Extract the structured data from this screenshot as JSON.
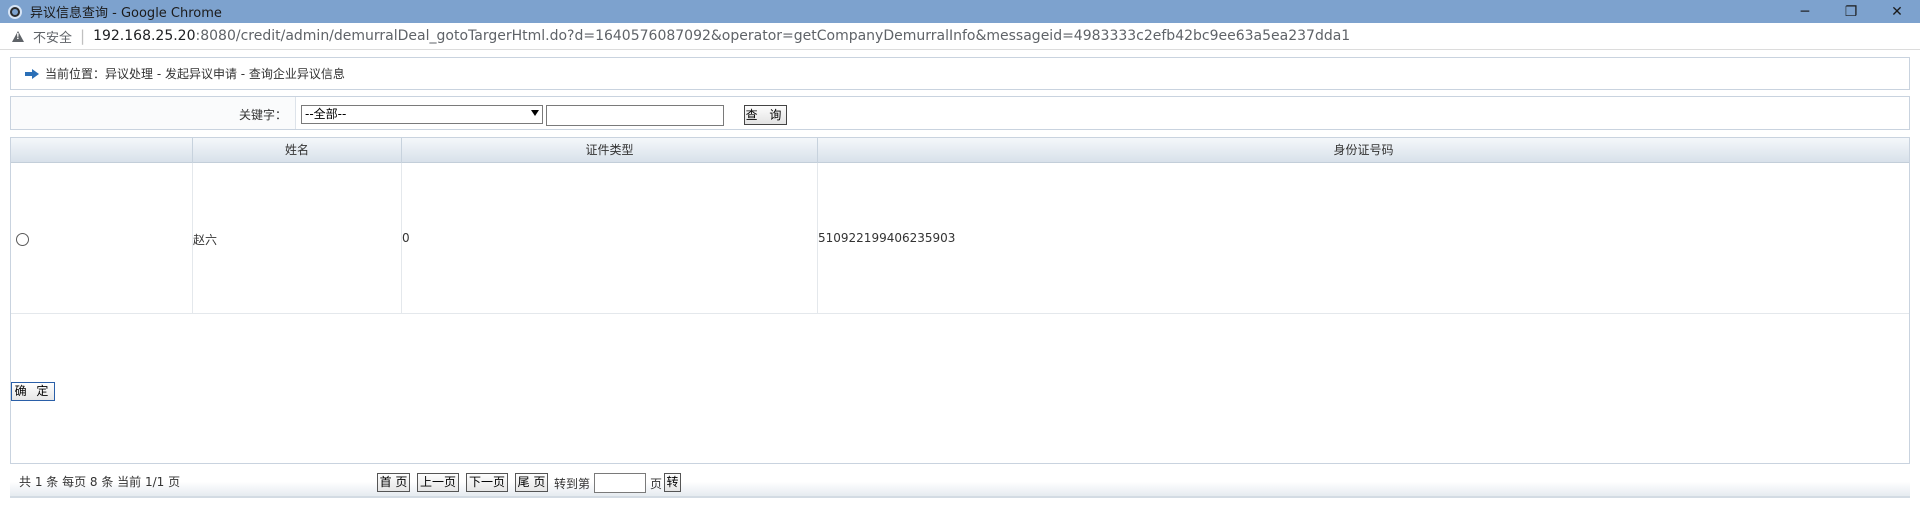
{
  "window": {
    "title": "异议信息查询 - Google Chrome",
    "minimize": "─",
    "restore": "❐",
    "close": "✕"
  },
  "address_bar": {
    "security_label": "不安全",
    "url_host": "192.168.25.20",
    "url_rest": ":8080/credit/admin/demurralDeal_gotoTargerHtml.do?d=1640576087092&operator=getCompanyDemurralInfo&messageid=4983333c2efb42bc9ee63a5ea237dda1"
  },
  "breadcrumb": {
    "text": "当前位置：异议处理 - 发起异议申请 - 查询企业异议信息"
  },
  "search": {
    "label": "关键字：",
    "select_value": "--全部--",
    "input_value": "",
    "button_label": "查 询"
  },
  "table": {
    "headers": [
      "",
      "姓名",
      "证件类型",
      "身份证号码"
    ],
    "rows": [
      {
        "name": "赵六",
        "id_type": "0",
        "id_number": "510922199406235903"
      }
    ]
  },
  "confirm_button": "确 定",
  "pagination": {
    "info": "共 1 条  每页 8  条 当前 1/1 页",
    "first": "首 页",
    "prev": "上一页",
    "next": "下一页",
    "last": "尾 页",
    "goto_label": "转到第",
    "page_unit": "页",
    "go": "转",
    "page_input": ""
  }
}
